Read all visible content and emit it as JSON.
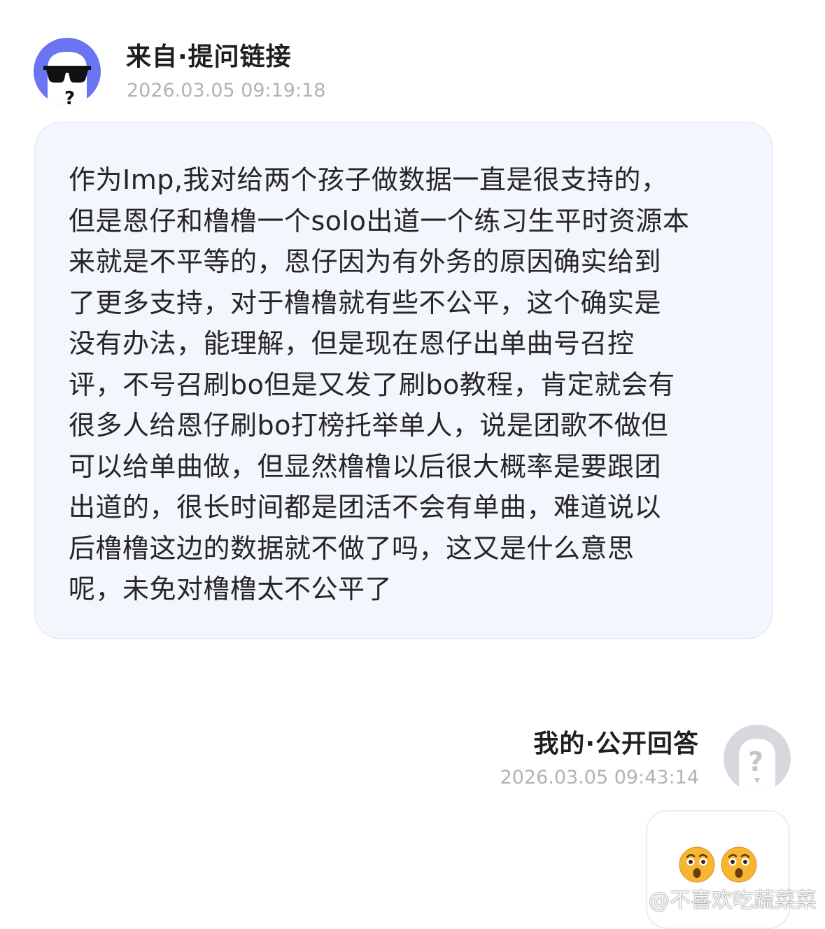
{
  "question": {
    "avatar_icon": "sunglasses-ghost-avatar-icon",
    "title": "来自·提问链接",
    "timestamp": "2026.03.05 09:19:18",
    "lines": [
      "作为Imp,我对给两个孩子做数据一直是很支持的，",
      "但是恩仔和橹橹一个solo出道一个练习生平时资源本",
      "来就是不平等的，恩仔因为有外务的原因确实给到",
      "了更多支持，对于橹橹就有些不公平，这个确实是",
      "没有办法，能理解，但是现在恩仔出单曲号召控",
      "评，不号召刷bo但是又发了刷bo教程，肯定就会有",
      "很多人给恩仔刷bo打榜托举单人，说是团歌不做但",
      "可以给单曲做，但显然橹橹以后很大概率是要跟团",
      "出道的，很长时间都是团活不会有单曲，难道说以",
      "后橹橹这边的数据就不做了吗，这又是什么意思",
      "呢，未免对橹橹太不公平了"
    ]
  },
  "answer": {
    "title": "我的·公开回答",
    "timestamp": "2026.03.05 09:43:14",
    "avatar_icon": "question-mark-avatar-icon",
    "emojis": [
      "surprised-face-emoji",
      "surprised-face-emoji"
    ]
  },
  "watermark": {
    "icon": "weibo-logo-icon",
    "text": "@不喜欢吃蔬菜菜"
  },
  "colors": {
    "avatar_purple": "#6b74f2",
    "bubble_bg": "#f3f6fc",
    "timestamp_gray": "#b3b3b3",
    "answer_avatar_gray": "#d6d8de"
  }
}
